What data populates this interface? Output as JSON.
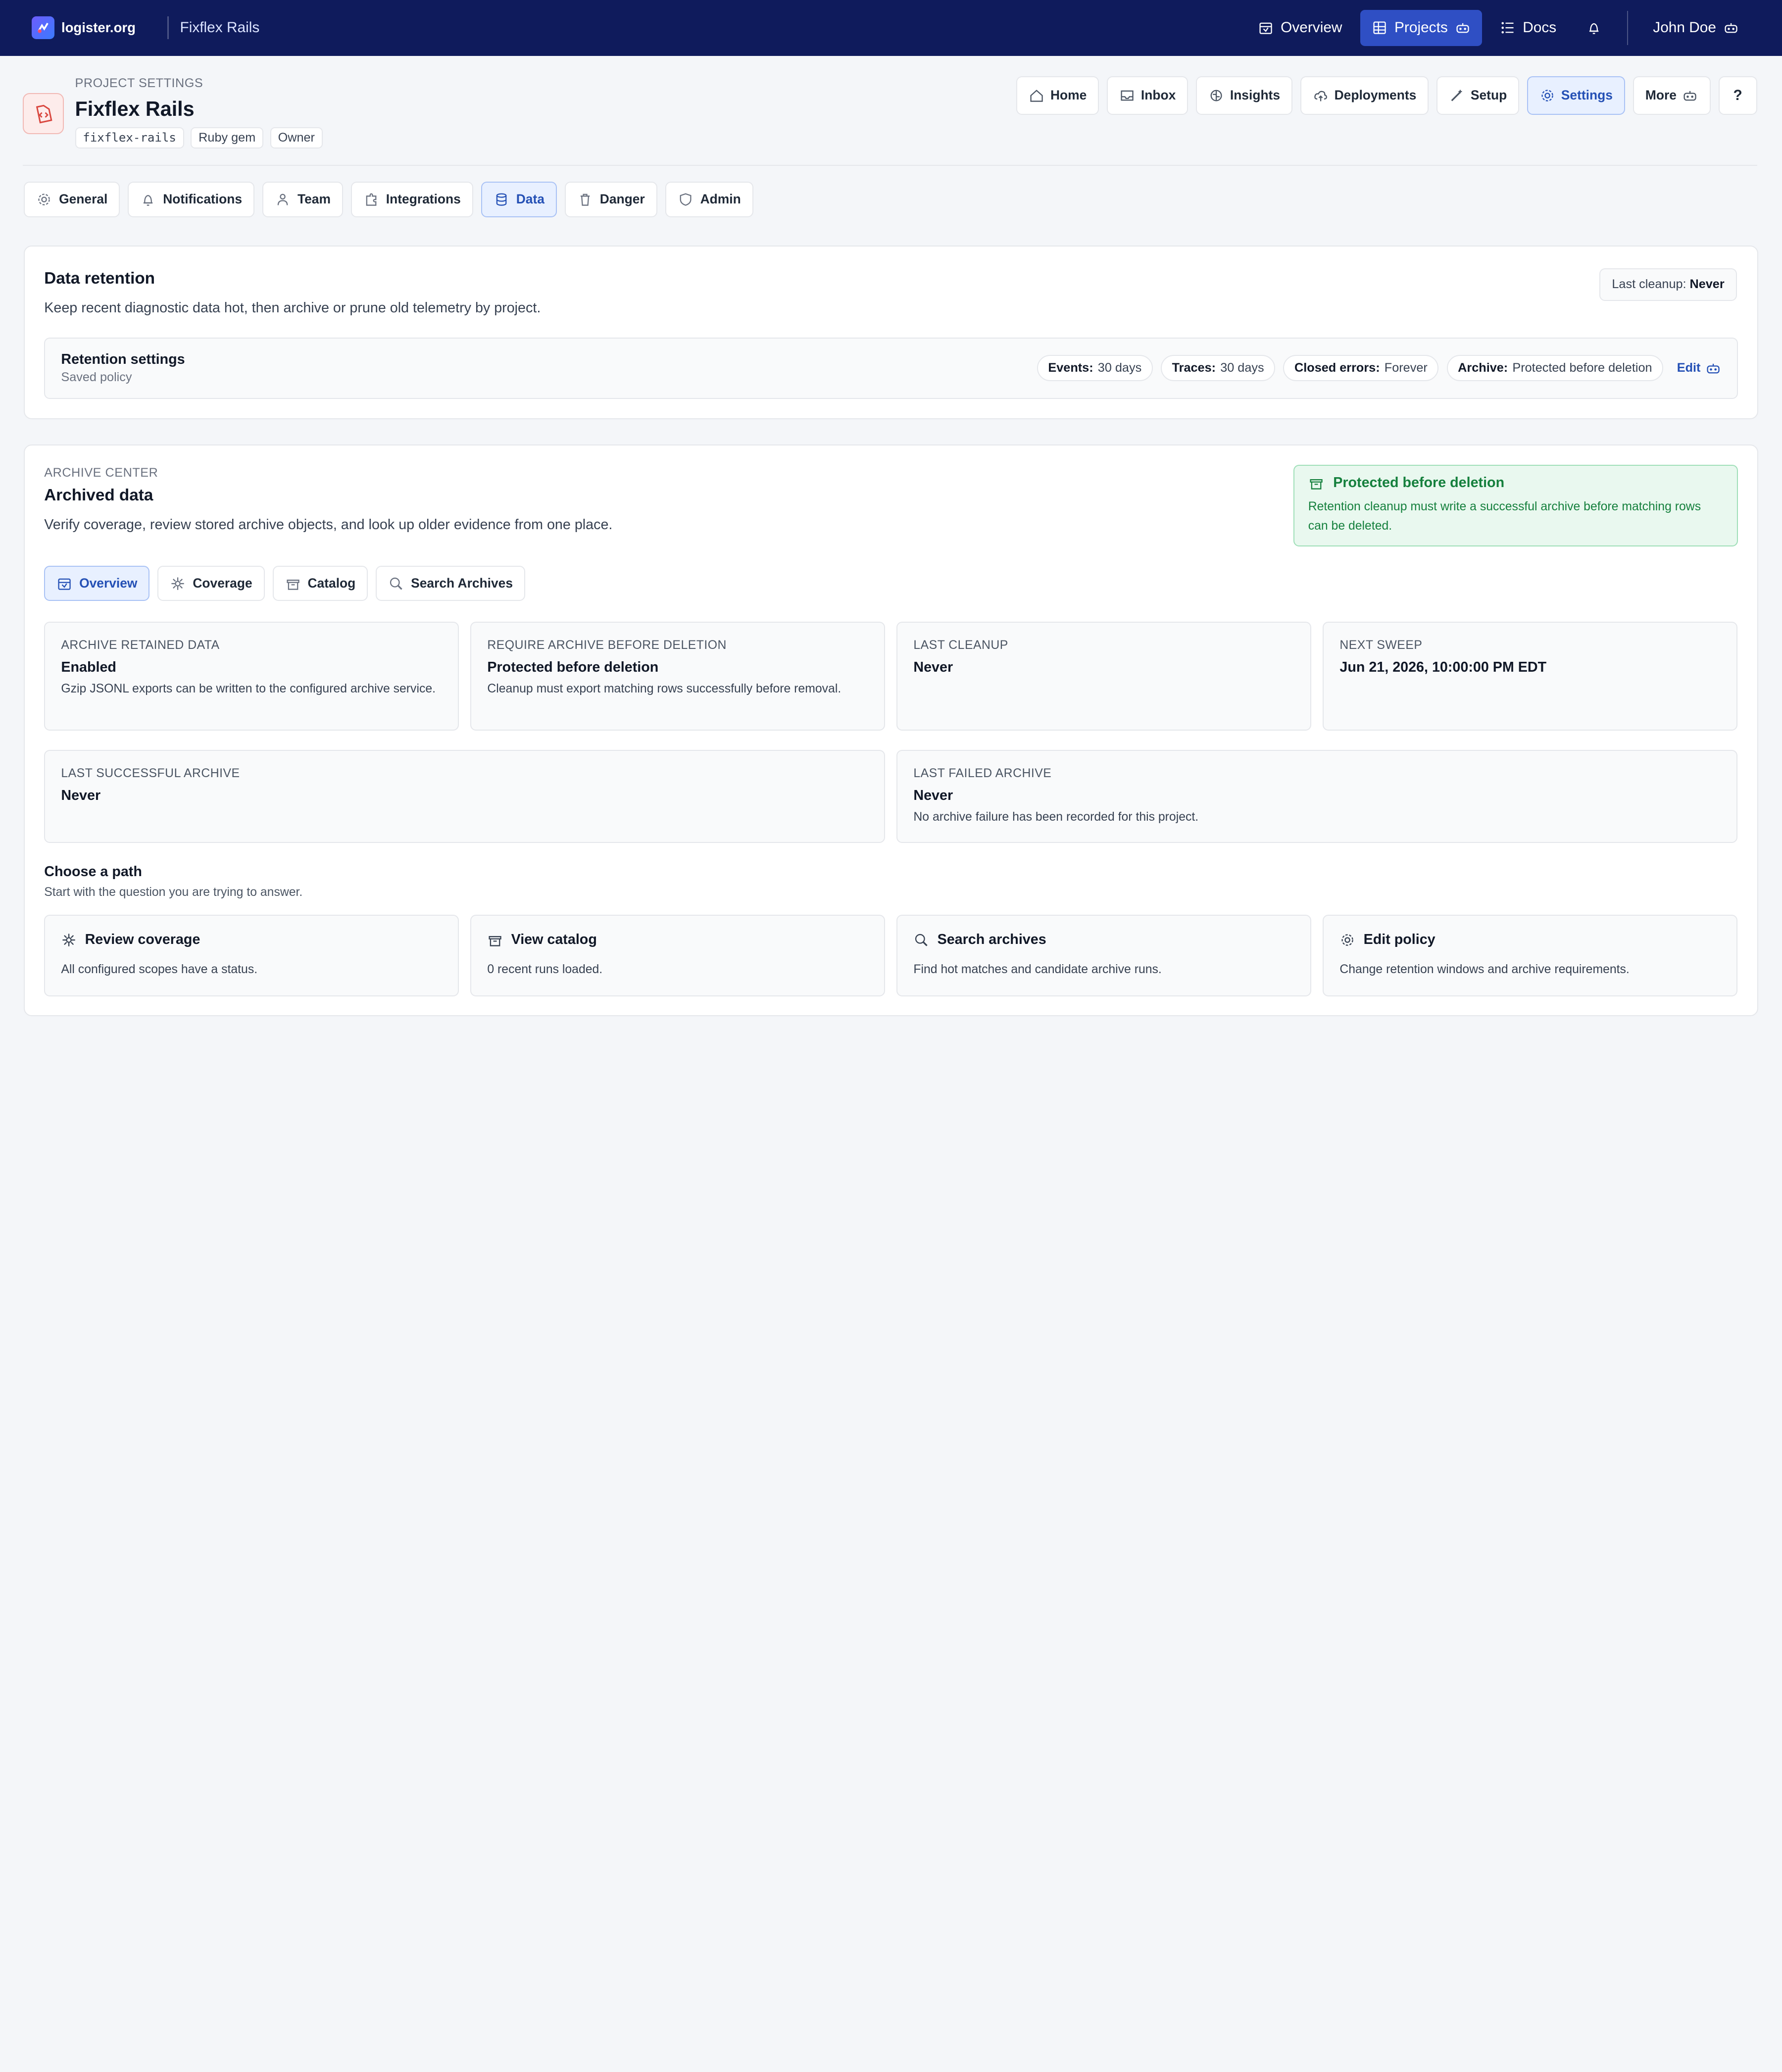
{
  "topbar": {
    "brand": "logister.org",
    "project": "Fixflex Rails",
    "nav": [
      {
        "label": "Overview",
        "icon": "calendar-icon"
      },
      {
        "label": "Projects",
        "icon": "grid-icon"
      },
      {
        "label": "Docs",
        "icon": "list-icon"
      }
    ],
    "user": "John Doe"
  },
  "header": {
    "eyebrow": "PROJECT SETTINGS",
    "title": "Fixflex Rails",
    "chips": [
      "fixflex-rails",
      "Ruby gem",
      "Owner"
    ],
    "tabs": [
      "Home",
      "Inbox",
      "Insights",
      "Deployments",
      "Setup",
      "Settings",
      "More"
    ],
    "help": "?"
  },
  "settings_tabs": [
    "General",
    "Notifications",
    "Team",
    "Integrations",
    "Data",
    "Danger",
    "Admin"
  ],
  "retention": {
    "title": "Data retention",
    "desc": "Keep recent diagnostic data hot, then archive or prune old telemetry by project.",
    "last_cleanup_label": "Last cleanup:",
    "last_cleanup_value": "Never",
    "box_title": "Retention settings",
    "box_sub": "Saved policy",
    "tags": [
      {
        "k": "Events:",
        "v": "30 days"
      },
      {
        "k": "Traces:",
        "v": "30 days"
      },
      {
        "k": "Closed errors:",
        "v": "Forever"
      },
      {
        "k": "Archive:",
        "v": "Protected before deletion"
      }
    ],
    "edit": "Edit"
  },
  "archive": {
    "eyebrow": "ARCHIVE CENTER",
    "title": "Archived data",
    "desc": "Verify coverage, review stored archive objects, and look up older evidence from one place.",
    "protected_title": "Protected before deletion",
    "protected_desc": "Retention cleanup must write a successful archive before matching rows can be deleted.",
    "tabs": [
      "Overview",
      "Coverage",
      "Catalog",
      "Search Archives"
    ],
    "stats": [
      {
        "k": "ARCHIVE RETAINED DATA",
        "v": "Enabled",
        "d": "Gzip JSONL exports can be written to the configured archive service."
      },
      {
        "k": "REQUIRE ARCHIVE BEFORE DELETION",
        "v": "Protected before deletion",
        "d": "Cleanup must export matching rows successfully before removal."
      },
      {
        "k": "LAST CLEANUP",
        "v": "Never",
        "d": ""
      },
      {
        "k": "NEXT SWEEP",
        "v": "Jun 21, 2026, 10:00:00 PM EDT",
        "d": ""
      },
      {
        "k": "LAST SUCCESSFUL ARCHIVE",
        "v": "Never",
        "d": ""
      },
      {
        "k": "LAST FAILED ARCHIVE",
        "v": "Never",
        "d": "No archive failure has been recorded for this project."
      }
    ],
    "path_title": "Choose a path",
    "path_sub": "Start with the question you are trying to answer.",
    "paths": [
      {
        "t": "Review coverage",
        "s": "All configured scopes have a status."
      },
      {
        "t": "View catalog",
        "s": "0 recent runs loaded."
      },
      {
        "t": "Search archives",
        "s": "Find hot matches and candidate archive runs."
      },
      {
        "t": "Edit policy",
        "s": "Change retention windows and archive requirements."
      }
    ]
  },
  "colors": {
    "nav_bg": "#0f1b5c",
    "accent": "#2450b5",
    "success": "#15803d"
  }
}
